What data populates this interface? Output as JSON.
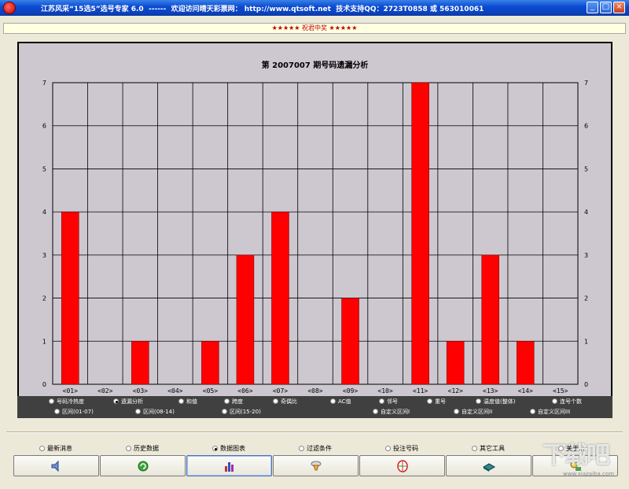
{
  "window": {
    "title": "江苏风采“15选5”选号专家 6.0  ------  欢迎访问晴天彩票网： http://www.qtsoft.net  技术支持QQ：2723T0858 或 563010061"
  },
  "banner": {
    "text": "★★★★★ 祝君中奖 ★★★★★"
  },
  "chart_data": {
    "type": "bar",
    "title": "第 2007007 期号码遗漏分析",
    "categories": [
      "<01>",
      "<02>",
      "<03>",
      "<04>",
      "<05>",
      "<06>",
      "<07>",
      "<08>",
      "<09>",
      "<10>",
      "<11>",
      "<12>",
      "<13>",
      "<14>",
      "<15>"
    ],
    "values": [
      4,
      0,
      1,
      0,
      1,
      3,
      4,
      0,
      2,
      0,
      7,
      1,
      3,
      1,
      0
    ],
    "ylim": [
      0,
      7
    ],
    "yticks": [
      0,
      1,
      2,
      3,
      4,
      5,
      6,
      7
    ],
    "grid": true,
    "bar_color": "#ff0000",
    "background": "#cdc8d0"
  },
  "analysis_options": [
    {
      "label": "号码冷热度",
      "selected": false
    },
    {
      "label": "遗漏分析",
      "selected": true
    },
    {
      "label": "和值",
      "selected": false
    },
    {
      "label": "跨度",
      "selected": false
    },
    {
      "label": "奇偶比",
      "selected": false
    },
    {
      "label": "AC值",
      "selected": false
    },
    {
      "label": "邻号",
      "selected": false
    },
    {
      "label": "重号",
      "selected": false
    },
    {
      "label": "温度值(整体)",
      "selected": false
    },
    {
      "label": "连号个数",
      "selected": false
    },
    {
      "label": "区间(01-07)",
      "selected": false
    },
    {
      "label": "区间(08-14)",
      "selected": false
    },
    {
      "label": "区间(15-20)",
      "selected": false
    },
    {
      "label": "自定义区间I",
      "selected": false
    },
    {
      "label": "自定义区间II",
      "selected": false
    },
    {
      "label": "自定义区间III",
      "selected": false
    }
  ],
  "nav": {
    "options": [
      {
        "label": "最新消息",
        "selected": false
      },
      {
        "label": "历史数据",
        "selected": false
      },
      {
        "label": "数据图表",
        "selected": true
      },
      {
        "label": "过滤条件",
        "selected": false
      },
      {
        "label": "投注号码",
        "selected": false
      },
      {
        "label": "其它工具",
        "selected": false
      },
      {
        "label": "关于...",
        "selected": false
      }
    ],
    "buttons": [
      {
        "icon": "speaker-icon"
      },
      {
        "icon": "refresh-icon"
      },
      {
        "icon": "bar-chart-icon"
      },
      {
        "icon": "filter-icon"
      },
      {
        "icon": "target-icon"
      },
      {
        "icon": "tools-icon"
      },
      {
        "icon": "about-icon"
      }
    ]
  },
  "watermark": {
    "text": "下载吧",
    "sub": "www.xiazaiba.com"
  }
}
